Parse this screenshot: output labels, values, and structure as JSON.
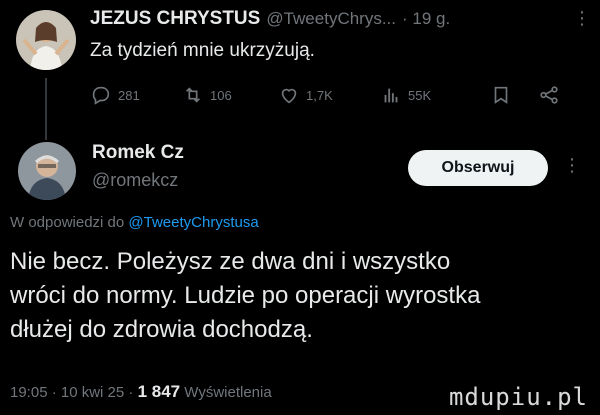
{
  "tweet1": {
    "author_name": "JEZUS CHRYSTUS",
    "handle": "@TweetyChrys...",
    "time": "· 19 g.",
    "more": "⋮",
    "text": "Za tydzień mnie ukrzyżują.",
    "stats": {
      "replies": "281",
      "retweets": "106",
      "likes": "1,7K",
      "views": "55K"
    }
  },
  "tweet2": {
    "author_name": "Romek Cz",
    "handle": "@romekcz",
    "follow_label": "Obserwuj",
    "more": "⋮",
    "reply_prefix": "W odpowiedzi do ",
    "reply_mention": "@TweetyChrystusa",
    "text_lines": [
      "Nie becz. Poleżysz ze dwa dni i wszystko",
      "wróci do normy. Ludzie po operacji wyrostka",
      "dłużej do zdrowia dochodzą."
    ],
    "time": "19:05 · 10 kwi 25 · ",
    "views_count": "1 847",
    "views_label": " Wyświetlenia"
  },
  "watermark": "mdupiu.pl",
  "icons": [
    "reply-icon",
    "retweet-icon",
    "heart-icon",
    "views-icon",
    "bookmark-icon",
    "share-icon"
  ],
  "colors": {
    "background": "#000000",
    "text": "#e7e9ea",
    "muted": "#71767b",
    "link": "#1d9bf0",
    "button": "#eff3f4"
  }
}
